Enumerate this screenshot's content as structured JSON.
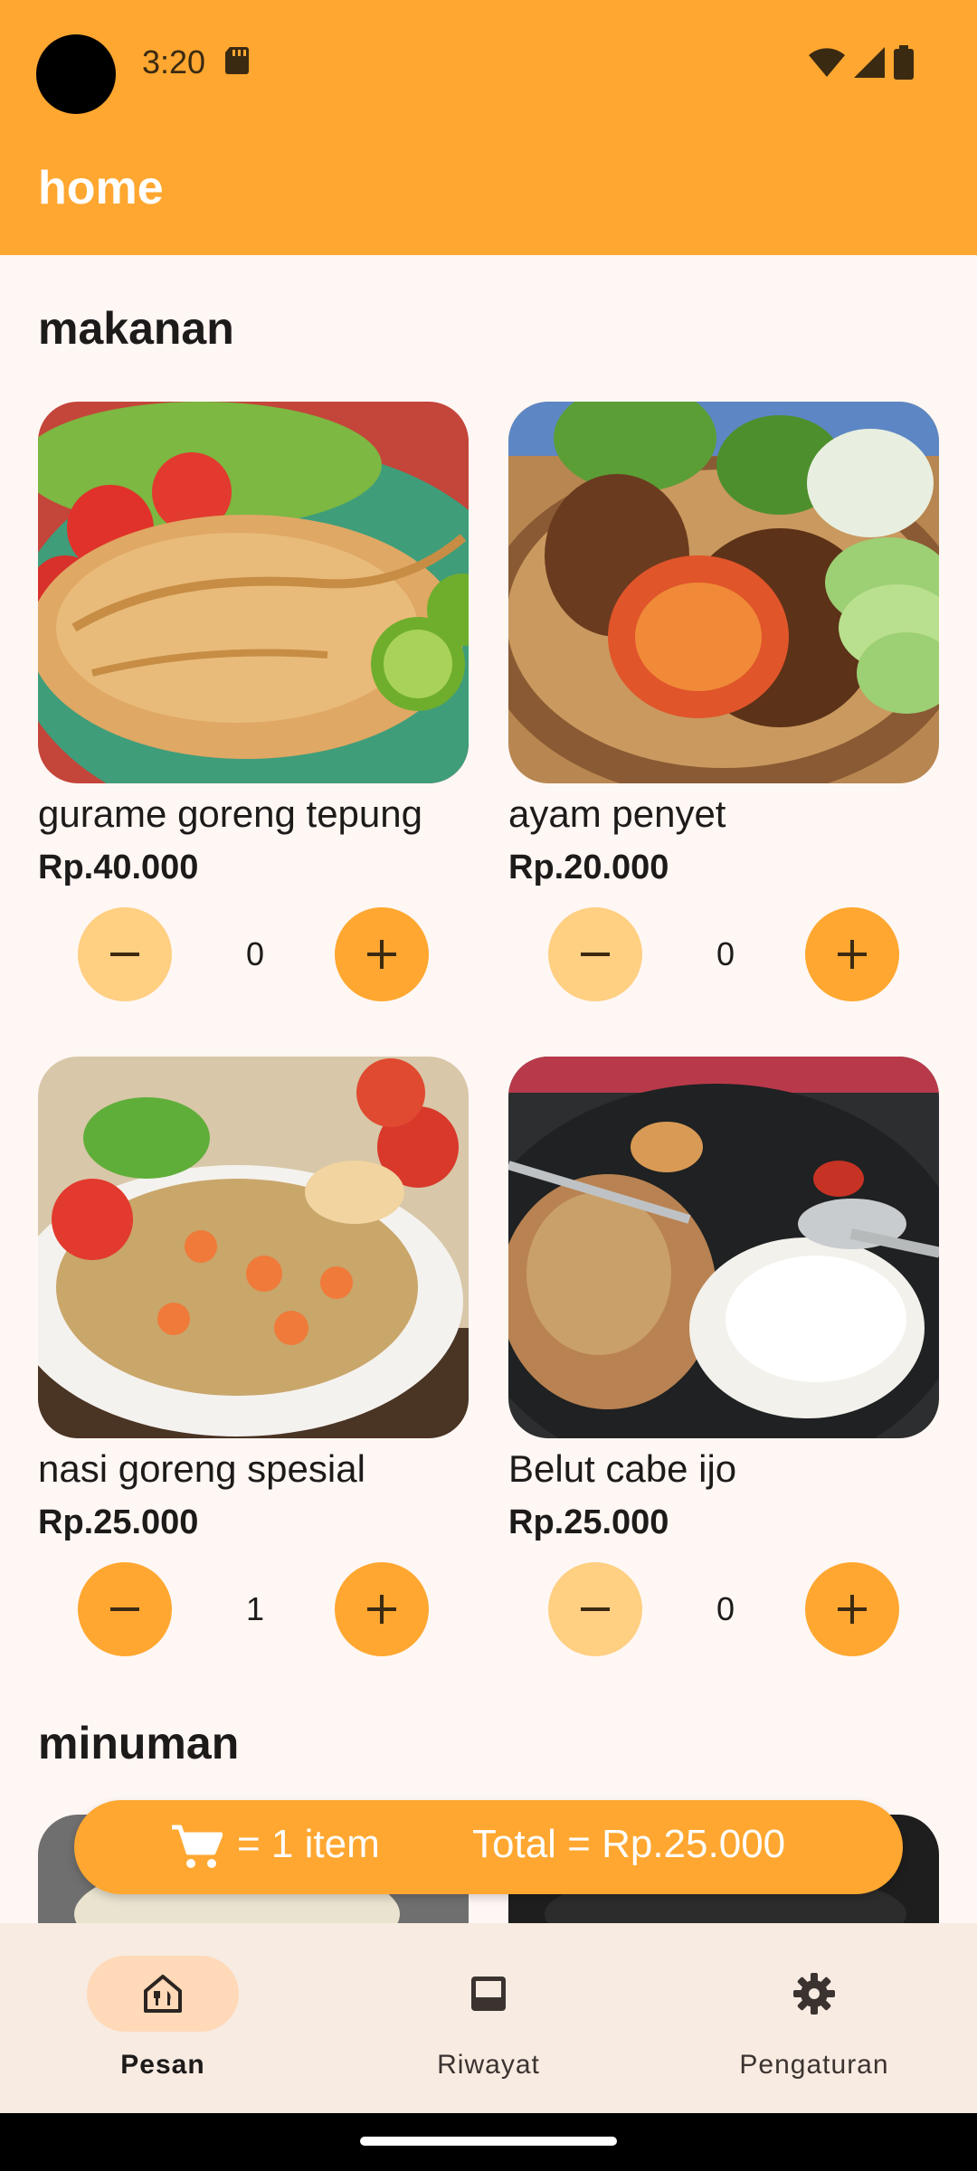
{
  "status_bar": {
    "time": "3:20"
  },
  "app_bar": {
    "title": "home"
  },
  "sections": {
    "makanan": {
      "title": "makanan"
    },
    "minuman": {
      "title": "minuman"
    }
  },
  "foods": [
    {
      "name": "gurame goreng tepung",
      "price": "Rp.40.000",
      "qty": "0"
    },
    {
      "name": "ayam penyet",
      "price": "Rp.20.000",
      "qty": "0"
    },
    {
      "name": "nasi goreng spesial",
      "price": "Rp.25.000",
      "qty": "1"
    },
    {
      "name": "Belut cabe ijo",
      "price": "Rp.25.000",
      "qty": "0"
    }
  ],
  "cart": {
    "items": "= 1 item",
    "total": "Total = Rp.25.000",
    "icon": "shopping-cart-icon"
  },
  "nav": {
    "items": [
      {
        "label": "Pesan",
        "icon": "restaurant-home-icon",
        "active": true
      },
      {
        "label": "Riwayat",
        "icon": "inbox-icon",
        "active": false
      },
      {
        "label": "Pengaturan",
        "icon": "gear-icon",
        "active": false
      }
    ]
  },
  "colors": {
    "accent": "#ffa730",
    "accent_disabled": "#ffcf82",
    "background": "#fff7f4",
    "nav_background": "#f7ebe2"
  }
}
